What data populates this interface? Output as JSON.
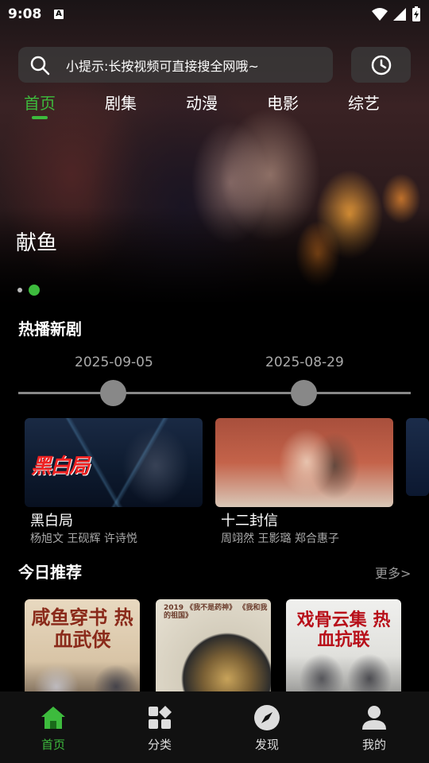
{
  "status_bar": {
    "time": "9:08",
    "notification_icon": "A"
  },
  "search": {
    "hint": "小提示:长按视频可直接搜全网哦~"
  },
  "tabs": [
    {
      "label": "首页",
      "active": true
    },
    {
      "label": "剧集",
      "active": false
    },
    {
      "label": "动漫",
      "active": false
    },
    {
      "label": "电影",
      "active": false
    },
    {
      "label": "综艺",
      "active": false
    }
  ],
  "banner": {
    "title": "献鱼",
    "page_count": 2,
    "active_page": 2
  },
  "hot_section": {
    "title": "热播新剧",
    "dates": [
      "2025-09-05",
      "2025-08-29"
    ],
    "cards": [
      {
        "title": "黑白局",
        "cast": "杨旭文 王砚辉 许诗悦",
        "poster_text": "黑白局"
      },
      {
        "title": "十二封信",
        "cast": "周翊然 王影璐 郑合惠子"
      }
    ]
  },
  "today_section": {
    "title": "今日推荐",
    "more_label": "更多>",
    "posters": [
      {
        "caption": "咸鱼穿书 热血武侠"
      },
      {
        "caption": "2019 《我不是药神》 《我和我的祖国》"
      },
      {
        "caption": "戏骨云集 热血抗联"
      }
    ]
  },
  "bottom_nav": [
    {
      "label": "首页",
      "icon": "home-icon",
      "active": true
    },
    {
      "label": "分类",
      "icon": "category-icon",
      "active": false
    },
    {
      "label": "发现",
      "icon": "compass-icon",
      "active": false
    },
    {
      "label": "我的",
      "icon": "user-icon",
      "active": false
    }
  ],
  "colors": {
    "accent": "#3dbb3d",
    "background": "#000000",
    "muted_text": "#aaaaaa"
  }
}
